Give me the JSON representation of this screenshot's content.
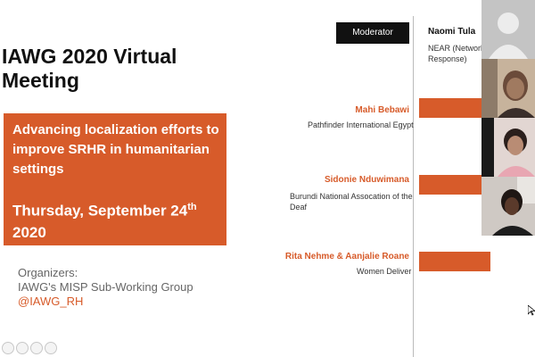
{
  "slide": {
    "title": "IAWG 2020 Virtual Meeting",
    "subtitle": "Advancing localization efforts to improve SRHR in humanitarian settings",
    "date_text": "Thursday, September 24",
    "date_sup": "th",
    "date_year": "2020",
    "organizers_label": "Organizers:",
    "organizers_group": "IAWG's MISP Sub-Working Group",
    "organizers_handle": "@IAWG_RH"
  },
  "moderator": {
    "label": "Moderator",
    "name": "Naomi Tula",
    "affiliation_line1": "NEAR (Network",
    "affiliation_line2": "Response)"
  },
  "speakers": [
    {
      "name": "Mahi Bebawi",
      "affiliation": "Pathfinder International Egypt"
    },
    {
      "name": "Sidonie Nduwimana",
      "affiliation_line1": "Burundi National Assocation of the",
      "affiliation_line2": "Deaf"
    },
    {
      "name": "Rita Nehme & Aanjalie Roane",
      "affiliation": "Women Deliver"
    }
  ],
  "colors": {
    "accent": "#d75b2a",
    "dark": "#111111"
  },
  "video_tiles": [
    "participant-video-1",
    "participant-video-2",
    "participant-video-3",
    "participant-video-4"
  ]
}
